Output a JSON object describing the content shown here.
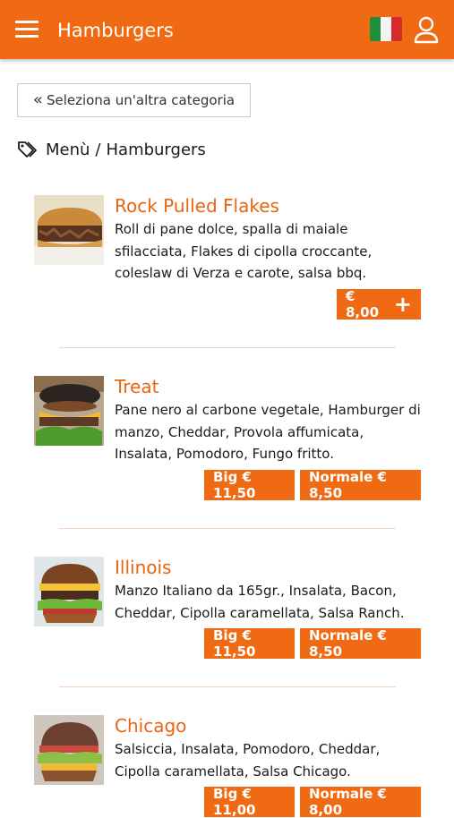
{
  "header": {
    "title": "Hamburgers",
    "menu_icon": "hamburger-menu-icon",
    "flag_icon": "italian-flag-icon",
    "user_icon": "user-icon"
  },
  "back_button": {
    "label": "Seleziona un'altra categoria",
    "icon": "double-chevron-left-icon"
  },
  "breadcrumb": {
    "icon": "tags-icon",
    "root": "Menù",
    "separator": "/",
    "current": "Hamburgers"
  },
  "items": [
    {
      "name": "Rock Pulled Flakes",
      "description": "Roll di pane dolce, spalla di maiale sfilacciata, Flakes di cipolla croccante, coleslaw di Verza e carote, salsa bbq.",
      "prices": [
        {
          "label": "€ 8,00"
        }
      ]
    },
    {
      "name": "Treat",
      "description": "Pane nero al carbone vegetale, Hamburger di manzo, Cheddar, Provola affumicata, Insalata, Pomodoro, Fungo fritto.",
      "prices": [
        {
          "label": "Big € 11,50"
        },
        {
          "label": "Normale € 8,50"
        }
      ]
    },
    {
      "name": "Illinois",
      "description": "Manzo Italiano da 165gr., Insalata, Bacon, Cheddar, Cipolla caramellata, Salsa Ranch.",
      "prices": [
        {
          "label": "Big € 11,50"
        },
        {
          "label": "Normale € 8,50"
        }
      ]
    },
    {
      "name": "Chicago",
      "description": "Salsiccia, Insalata, Pomodoro, Cheddar, Cipolla caramellata, Salsa Chicago.",
      "prices": [
        {
          "label": "Big € 11,00"
        },
        {
          "label": "Normale € 8,00"
        }
      ]
    }
  ],
  "colors": {
    "accent": "#ef6a13",
    "item_title": "#e8650f",
    "divider": "#f3d3bd"
  }
}
